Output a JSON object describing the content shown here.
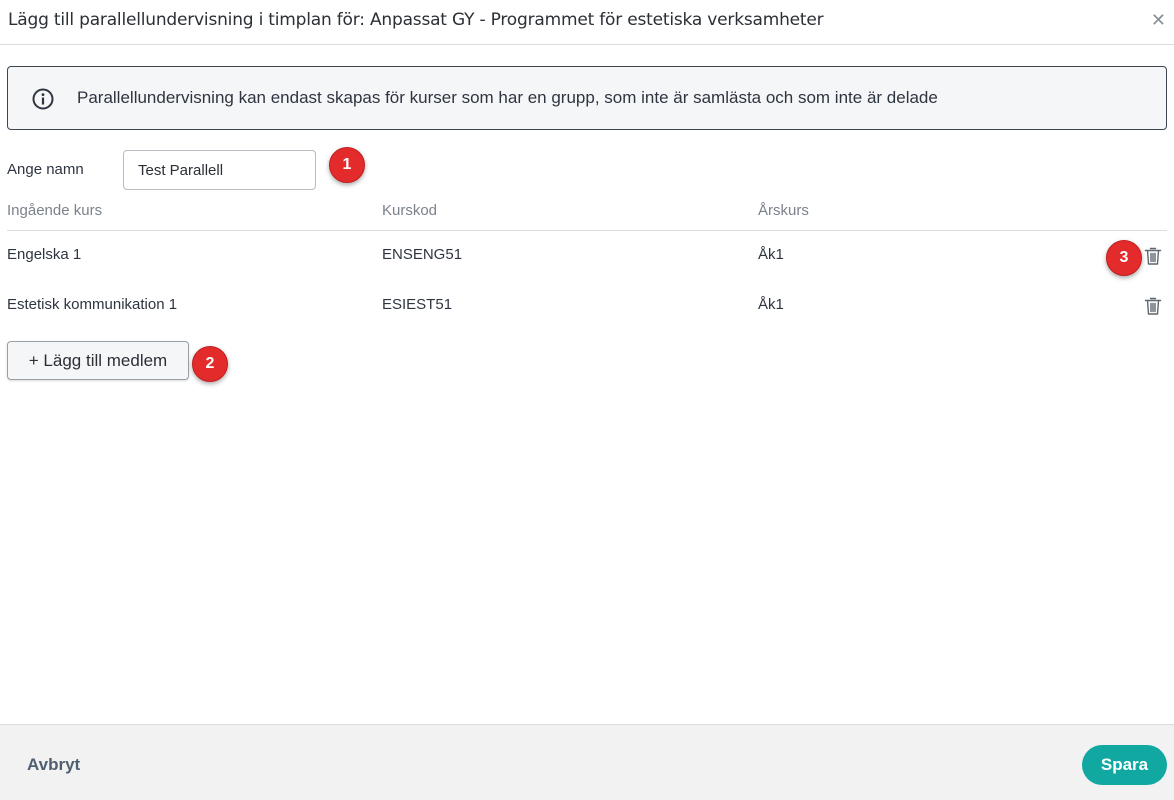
{
  "dialog": {
    "title": "Lägg till parallellundervisning i timplan för: Anpassat GY - Programmet för estetiska verksamheter",
    "close_icon": "close-icon"
  },
  "info": {
    "icon": "info-icon",
    "text": "Parallellundervisning kan endast skapas för kurser som har en grupp, som inte är samlästa och som inte är delade"
  },
  "form": {
    "name_label": "Ange namn",
    "name_value": "Test Parallell"
  },
  "table": {
    "columns": [
      "Ingående kurs",
      "Kurskod",
      "Årskurs"
    ],
    "rows": [
      {
        "course": "Engelska 1",
        "code": "ENSENG51",
        "year": "Åk1"
      },
      {
        "course": "Estetisk kommunikation 1",
        "code": "ESIEST51",
        "year": "Åk1"
      }
    ]
  },
  "add_member_label": "+ Lägg till medlem",
  "annotations": [
    "1",
    "2",
    "3"
  ],
  "footer": {
    "cancel_label": "Avbryt",
    "save_label": "Spara"
  },
  "colors": {
    "accent": "#12a8a2",
    "badge": "#e32b2b"
  }
}
